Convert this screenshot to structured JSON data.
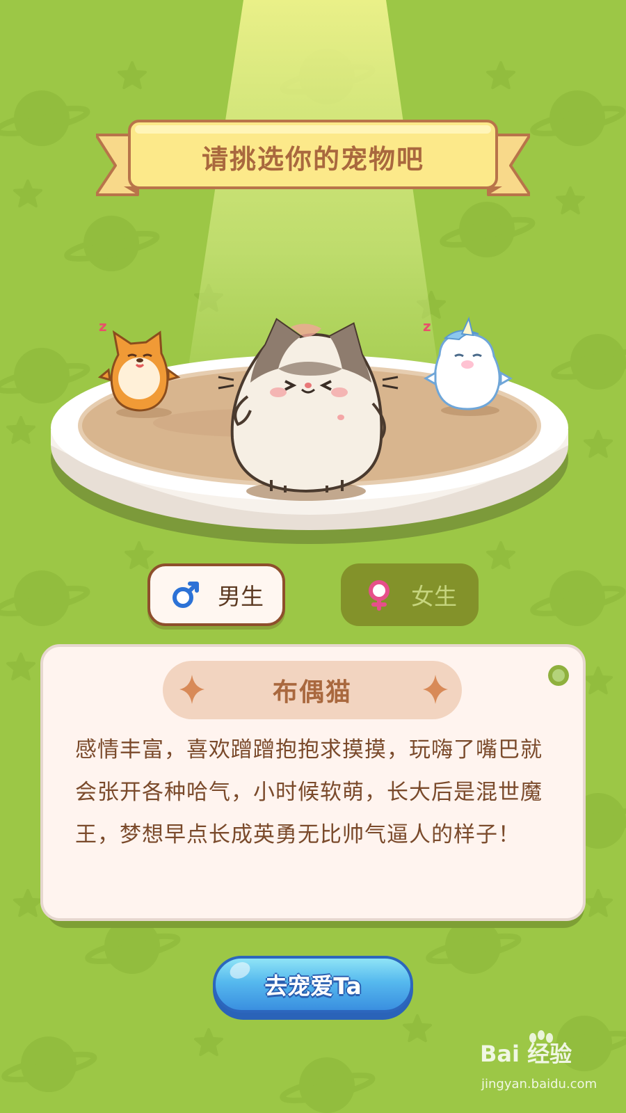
{
  "title": "请挑选你的宠物吧",
  "pets": [
    {
      "name": "shiba",
      "state": "sleeping",
      "sleep_mark": "z"
    },
    {
      "name": "ragdoll-cat",
      "state": "selected"
    },
    {
      "name": "unicorn",
      "state": "sleeping",
      "sleep_mark": "z"
    }
  ],
  "gender": {
    "male_label": "男生",
    "female_label": "女生",
    "selected": "male"
  },
  "pet_card": {
    "name": "布偶猫",
    "description": "感情丰富，喜欢蹭蹭抱抱求摸摸，玩嗨了嘴巴就会张开各种哈气，小时候软萌，长大后是混世魔王，梦想早点长成英勇无比帅气逼人的样子！"
  },
  "cta_label": "去宠爱Ta",
  "watermark": {
    "logo_text": "Bai 经验",
    "url": "jingyan.baidu.com"
  },
  "colors": {
    "background": "#9cc746",
    "title_text": "#a9683e",
    "banner_fill": "#fce98a",
    "male_icon": "#2c72d6",
    "female_icon": "#e64f8a",
    "cta_blue": "#3a8fe0"
  }
}
